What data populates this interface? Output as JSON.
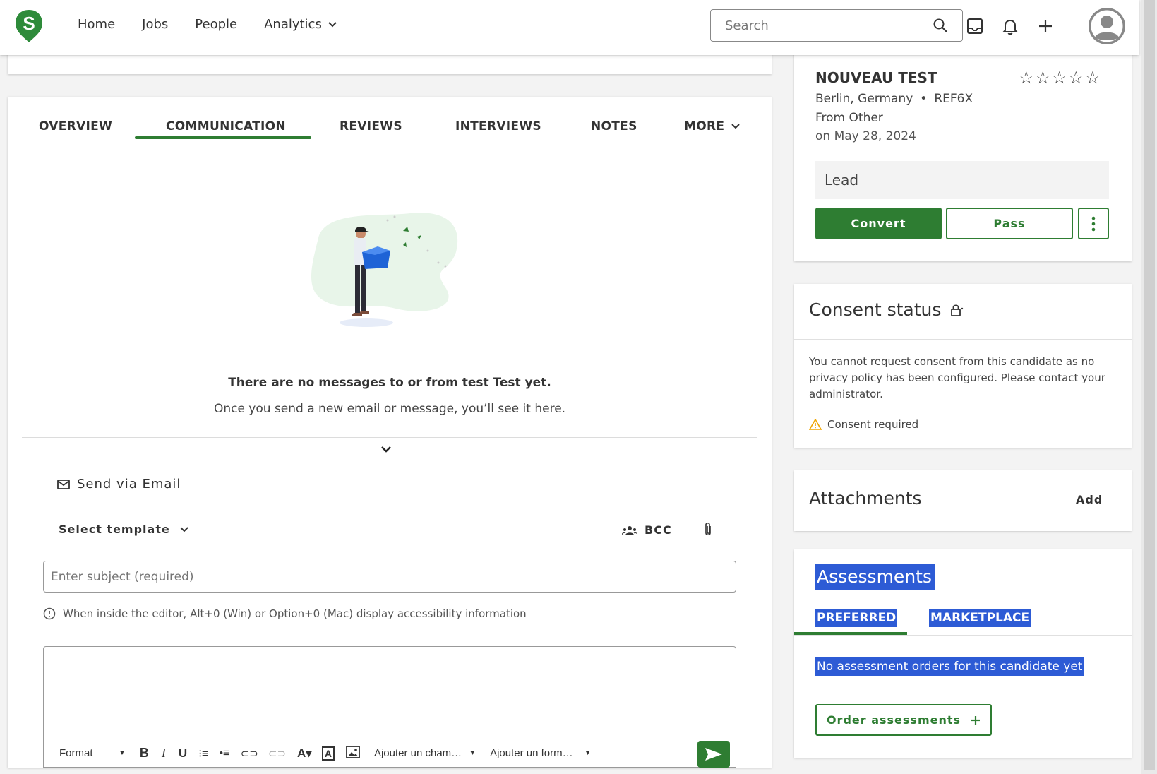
{
  "nav": {
    "logo_letter": "S",
    "items": [
      {
        "label": "Home"
      },
      {
        "label": "Jobs"
      },
      {
        "label": "People"
      },
      {
        "label": "Analytics"
      }
    ],
    "search_placeholder": "Search"
  },
  "tabs": [
    {
      "label": "OVERVIEW"
    },
    {
      "label": "COMMUNICATION"
    },
    {
      "label": "REVIEWS"
    },
    {
      "label": "INTERVIEWS"
    },
    {
      "label": "NOTES"
    },
    {
      "label": "MORE"
    }
  ],
  "empty_state": {
    "title": "There are no messages to or from test Test yet.",
    "subtitle": "Once you send a new email or message, you’ll see it here."
  },
  "composer": {
    "send_via": "Send via Email",
    "select_template": "Select template",
    "bcc": "BCC",
    "subject_placeholder": "Enter subject (required)",
    "accessibility_info": "When inside the editor, Alt+0 (Win) or Option+0 (Mac) display accessibility information",
    "toolbar": {
      "format": "Format",
      "insert_field": "Ajouter un cham…",
      "insert_form": "Ajouter un form…"
    }
  },
  "candidate": {
    "name": "NOUVEAU TEST",
    "location": "Berlin, Germany",
    "ref": "REF6X",
    "source": "From Other",
    "date": "on May 28, 2024",
    "stage": "Lead",
    "convert_label": "Convert",
    "pass_label": "Pass",
    "rating": 0,
    "rating_max": 5
  },
  "consent": {
    "title": "Consent status",
    "message": "You cannot request consent from this candidate as no privacy policy has been configured. Please contact your administrator.",
    "warning": "Consent required",
    "warning_color": "#f0a500"
  },
  "attachments": {
    "title": "Attachments",
    "add_label": "Add"
  },
  "assessments": {
    "title": "Assessments",
    "tabs": [
      {
        "label": "PREFERRED"
      },
      {
        "label": "MARKETPLACE"
      }
    ],
    "empty": "No assessment orders for this candidate yet",
    "order_label": "Order assessments"
  },
  "colors": {
    "accent": "#2e7d32",
    "selection_highlight": "#2d5bd5"
  }
}
